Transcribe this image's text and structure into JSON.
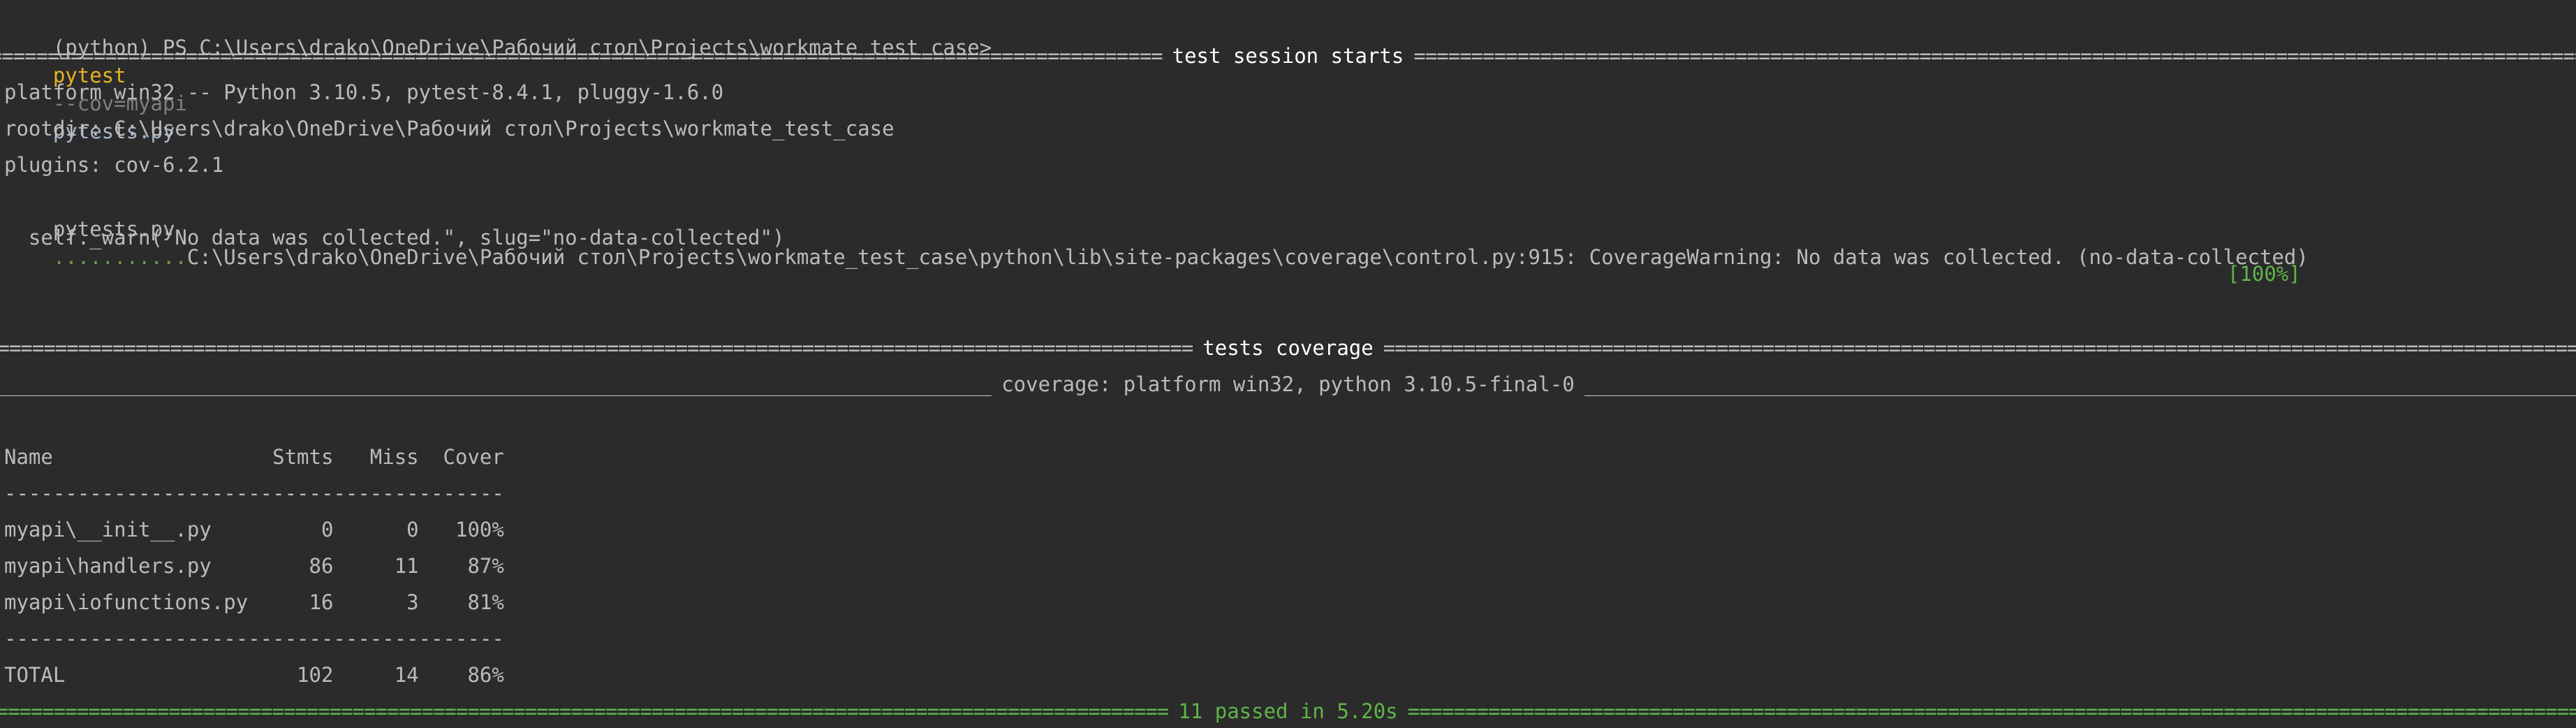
{
  "prompt": {
    "prefix": "(python) PS C:\\Users\\drako\\OneDrive\\Рабочий стол\\Projects\\workmate_test_case>",
    "command": "pytest",
    "option": "--cov=myapi",
    "target": "pytests.py"
  },
  "session": {
    "header": "test session starts",
    "platform": "platform win32 -- Python 3.10.5, pytest-8.4.1, pluggy-1.6.0",
    "rootdir": "rootdir: C:\\Users\\drako\\OneDrive\\Рабочий стол\\Projects\\workmate_test_case",
    "plugins": "plugins: cov-6.2.1",
    "test_file": "pytests.py",
    "progress_dots": "...........",
    "warning": "C:\\Users\\drako\\OneDrive\\Рабочий стол\\Projects\\workmate_test_case\\python\\lib\\site-packages\\coverage\\control.py:915: CoverageWarning: No data was collected. (no-data-collected)",
    "warn_call": "  self._warn(\"No data was collected.\", slug=\"no-data-collected\")",
    "percent": "[100%]"
  },
  "coverage": {
    "header": "tests coverage",
    "subheader": "coverage: platform win32, python 3.10.5-final-0",
    "columns": "Name                  Stmts   Miss  Cover",
    "divider": "-----------------------------------------",
    "rows": [
      "myapi\\__init__.py         0      0   100%",
      "myapi\\handlers.py        86     11    87%",
      "myapi\\iofunctions.py     16      3    81%"
    ],
    "total": "TOTAL                   102     14    86%"
  },
  "summary": {
    "text": "11 passed in 5.20s"
  },
  "colors": {
    "background": "#2b2b2b",
    "text": "#bbbbbb",
    "command": "#e6b422",
    "pass": "#5fb54a"
  }
}
